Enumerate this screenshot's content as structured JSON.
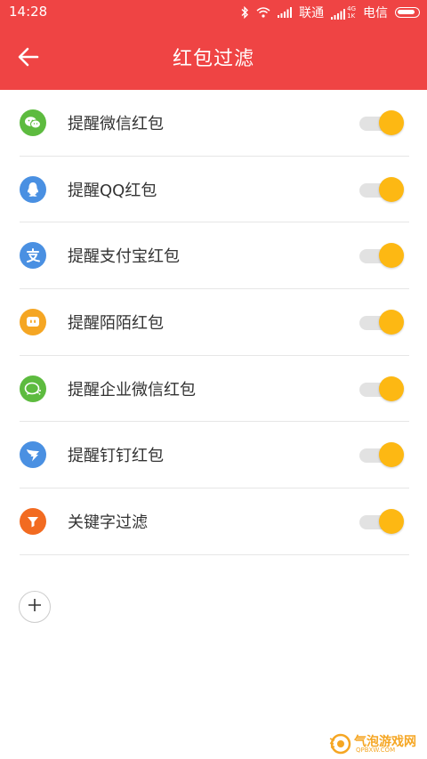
{
  "status_bar": {
    "time": "14:28",
    "carrier_1": "联通",
    "carrier_2": "电信",
    "network_4g": "4G",
    "network_1k": "1K"
  },
  "header": {
    "title": "红包过滤",
    "back_icon": "arrow-left-icon",
    "background": "#ef4444"
  },
  "filters": [
    {
      "label": "提醒微信红包",
      "icon": "wechat-icon",
      "icon_color": "#5dbb3f",
      "enabled": true
    },
    {
      "label": "提醒QQ红包",
      "icon": "qq-penguin-icon",
      "icon_color": "#4a90e2",
      "enabled": true
    },
    {
      "label": "提醒支付宝红包",
      "icon": "alipay-icon",
      "icon_color": "#4a90e2",
      "enabled": true
    },
    {
      "label": "提醒陌陌红包",
      "icon": "momo-icon",
      "icon_color": "#f5a623",
      "enabled": true
    },
    {
      "label": "提醒企业微信红包",
      "icon": "work-wechat-icon",
      "icon_color": "#5dbb3f",
      "enabled": true
    },
    {
      "label": "提醒钉钉红包",
      "icon": "dingtalk-icon",
      "icon_color": "#4a90e2",
      "enabled": true
    },
    {
      "label": "关键字过滤",
      "icon": "funnel-filter-icon",
      "icon_color": "#f26b21",
      "enabled": true
    }
  ],
  "toggle_on_color": "#fdb813",
  "add_button": {
    "icon": "plus-icon"
  },
  "watermark": {
    "text": "气泡游戏网",
    "sub": "QPBXW.COM"
  }
}
